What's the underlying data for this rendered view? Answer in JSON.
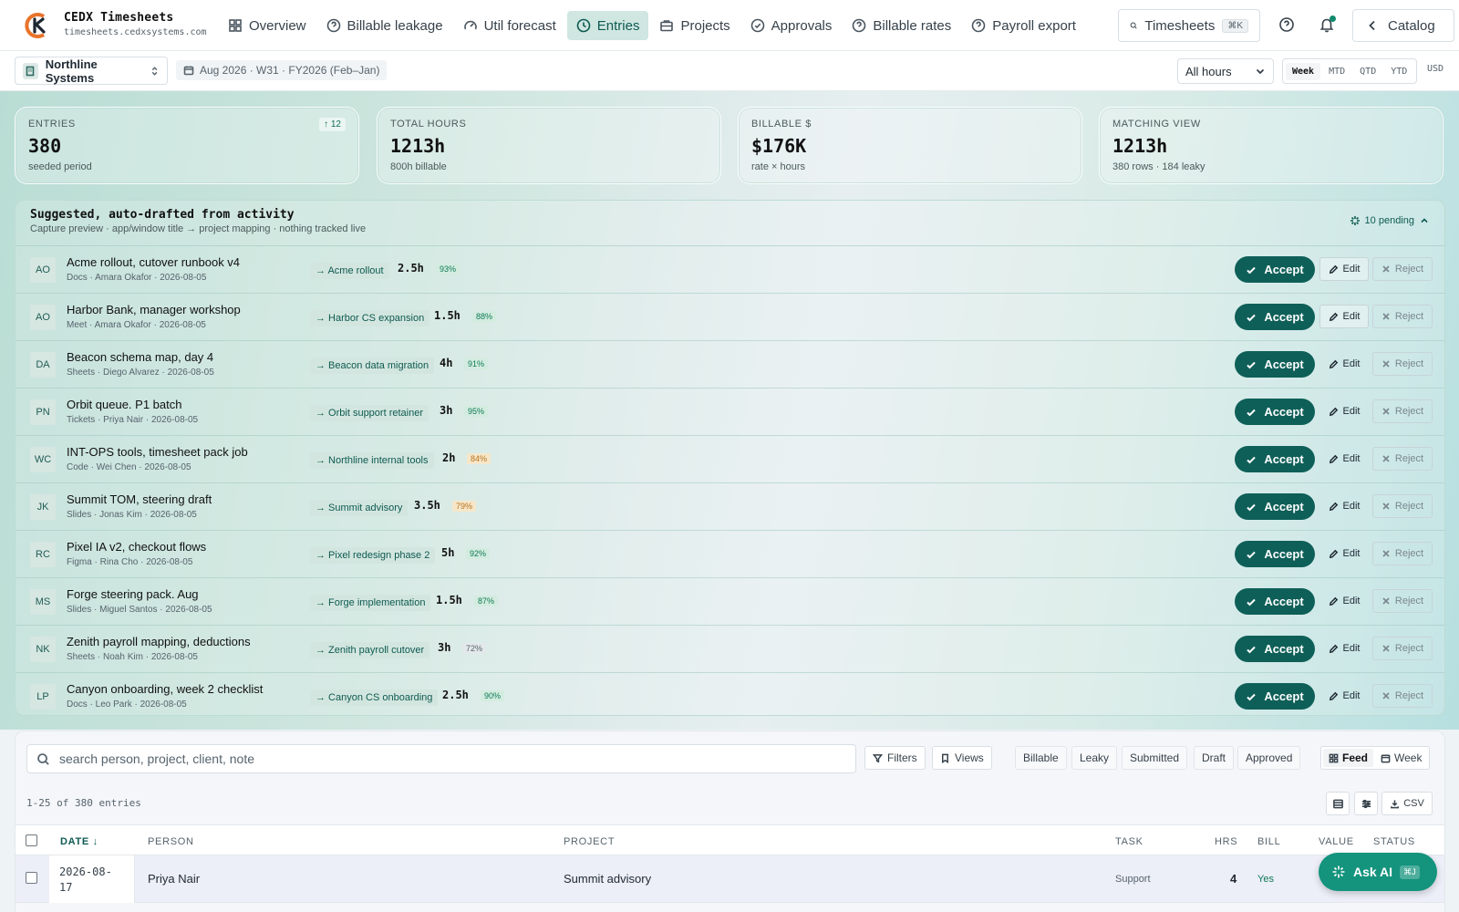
{
  "app": {
    "title": "CEDX Timesheets",
    "domain": "timesheets.cedxsystems.com"
  },
  "nav": [
    {
      "label": "Overview",
      "icon": "grid-icon"
    },
    {
      "label": "Billable leakage",
      "icon": "help-circle-icon"
    },
    {
      "label": "Util forecast",
      "icon": "gauge-icon"
    },
    {
      "label": "Entries",
      "icon": "clock-icon",
      "active": true
    },
    {
      "label": "Projects",
      "icon": "briefcase-icon"
    },
    {
      "label": "Approvals",
      "icon": "check-circle-icon"
    },
    {
      "label": "Billable rates",
      "icon": "help-circle-icon"
    },
    {
      "label": "Payroll export",
      "icon": "help-circle-icon"
    }
  ],
  "search_btn": {
    "label": "Timesheets",
    "shortcut": "⌘K"
  },
  "catalog": {
    "label": "Catalog"
  },
  "subbar": {
    "org": "Northline Systems",
    "period": "Aug 2026 · W31 · FY2026 (Feb–Jan)",
    "hours_filter": "All hours",
    "ranges": [
      "Week",
      "MTD",
      "QTD",
      "YTD"
    ],
    "active_range": "Week",
    "currency": "USD"
  },
  "stats": [
    {
      "label": "ENTRIES",
      "value": "380",
      "sub": "seeded period",
      "delta": "↑ 12"
    },
    {
      "label": "TOTAL HOURS",
      "value": "1213h",
      "sub": "800h billable"
    },
    {
      "label": "BILLABLE $",
      "value": "$176K",
      "sub": "rate × hours"
    },
    {
      "label": "MATCHING VIEW",
      "value": "1213h",
      "sub": "380 rows · 184 leaky"
    }
  ],
  "suggestions": {
    "title": "Suggested, auto-drafted from activity",
    "subtitle": "Capture preview · app/window title → project mapping · nothing tracked live",
    "pending": "10 pending",
    "accept_label": "Accept",
    "edit_label": "Edit",
    "reject_label": "Reject",
    "items": [
      {
        "initials": "AO",
        "title": "Acme rollout, cutover runbook v4",
        "meta": "Docs · Amara Okafor · 2026-08-05",
        "project": "→ Acme rollout",
        "hours": "2.5h",
        "conf": "93%",
        "level": "hi"
      },
      {
        "initials": "AO",
        "title": "Harbor Bank, manager workshop",
        "meta": "Meet · Amara Okafor · 2026-08-05",
        "project": "→ Harbor CS expansion",
        "hours": "1.5h",
        "conf": "88%",
        "level": "hi"
      },
      {
        "initials": "DA",
        "title": "Beacon schema map, day 4",
        "meta": "Sheets · Diego Alvarez · 2026-08-05",
        "project": "→ Beacon data migration",
        "hours": "4h",
        "conf": "91%",
        "level": "hi"
      },
      {
        "initials": "PN",
        "title": "Orbit queue. P1 batch",
        "meta": "Tickets · Priya Nair · 2026-08-05",
        "project": "→ Orbit support retainer",
        "hours": "3h",
        "conf": "95%",
        "level": "hi"
      },
      {
        "initials": "WC",
        "title": "INT-OPS tools, timesheet pack job",
        "meta": "Code · Wei Chen · 2026-08-05",
        "project": "→ Northline internal tools",
        "hours": "2h",
        "conf": "84%",
        "level": "mid"
      },
      {
        "initials": "JK",
        "title": "Summit TOM, steering draft",
        "meta": "Slides · Jonas Kim · 2026-08-05",
        "project": "→ Summit advisory",
        "hours": "3.5h",
        "conf": "79%",
        "level": "mid"
      },
      {
        "initials": "RC",
        "title": "Pixel IA v2, checkout flows",
        "meta": "Figma · Rina Cho · 2026-08-05",
        "project": "→ Pixel redesign phase 2",
        "hours": "5h",
        "conf": "92%",
        "level": "hi"
      },
      {
        "initials": "MS",
        "title": "Forge steering pack. Aug",
        "meta": "Slides · Miguel Santos · 2026-08-05",
        "project": "→ Forge implementation",
        "hours": "1.5h",
        "conf": "87%",
        "level": "hi"
      },
      {
        "initials": "NK",
        "title": "Zenith payroll mapping, deductions",
        "meta": "Sheets · Noah Kim · 2026-08-05",
        "project": "→ Zenith payroll cutover",
        "hours": "3h",
        "conf": "72%",
        "level": "lo"
      },
      {
        "initials": "LP",
        "title": "Canyon onboarding, week 2 checklist",
        "meta": "Docs · Leo Park · 2026-08-05",
        "project": "→ Canyon CS onboarding",
        "hours": "2.5h",
        "conf": "90%",
        "level": "hi"
      }
    ]
  },
  "entries": {
    "search_placeholder": "search person, project, client, note",
    "filters_label": "Filters",
    "views_label": "Views",
    "chips": [
      "Billable",
      "Leaky",
      "Submitted",
      "Draft",
      "Approved"
    ],
    "view_modes": [
      "Feed",
      "Week"
    ],
    "active_view": "Feed",
    "count": "1-25 of 380 entries",
    "csv_label": "CSV",
    "columns": {
      "date": "DATE ↓",
      "person": "PERSON",
      "project": "PROJECT",
      "task": "TASK",
      "hrs": "HRS",
      "bill": "BILL",
      "value": "VALUE",
      "status": "STATUS"
    },
    "rows": [
      {
        "date": "2026-08-17",
        "person": "Priya Nair",
        "project": "Summit advisory",
        "task": "Support",
        "hrs": "4",
        "bill": "Yes"
      }
    ]
  },
  "ask_ai": {
    "label": "Ask AI",
    "shortcut": "⌘J"
  }
}
